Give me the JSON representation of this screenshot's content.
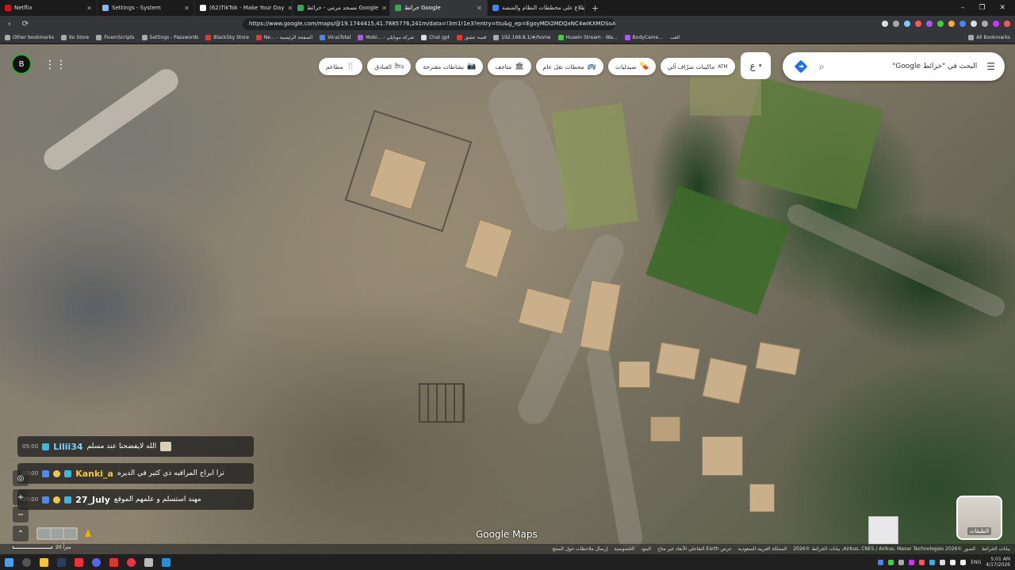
{
  "browser": {
    "tabs": [
      {
        "title": "Netflix",
        "color": "#e50914",
        "active": false
      },
      {
        "title": "Settings - System",
        "color": "#8ab4f8",
        "active": false
      },
      {
        "title": "(62)TikTok - Make Your Day",
        "color": "#ffffff",
        "active": false
      },
      {
        "title": "مسجد مرمي - خرائط Google",
        "color": "#34a853",
        "active": false
      },
      {
        "title": "خرائط Google",
        "color": "#34a853",
        "active": true
      },
      {
        "title": "الاطلاع على مخططات النظام والمنصة...",
        "color": "#4285f4",
        "active": false
      }
    ],
    "new_tab": "+",
    "window_controls": [
      "–",
      "❐",
      "✕"
    ],
    "url": "https://www.google.com/maps/@19.1744415,41.7885776,241m/data=!3m1!1e3?entry=ttu&g_ep=EgoyMDI2MDQxNC4wIKXMDSoASAFQ...",
    "nav": {
      "back": "‹",
      "forward": "›",
      "reload": "⟳"
    },
    "ext_colors": [
      "#ddd",
      "#aaa",
      "#7cf",
      "#f55",
      "#a5f",
      "#4c4",
      "#fa3",
      "#48f",
      "#ddd",
      "#aaa",
      "#c3f",
      "#f55"
    ],
    "bookmarks": [
      "Other bookmarks",
      "Ko Store",
      "FivemScripts",
      "Settings - Passwords",
      "BlackSky Store",
      "Ne... - الصفحة الرئيسية",
      "VirusTotal",
      "Mobi... - شركة موبايلي",
      "Chat gpt",
      "قصة عشق",
      "192.168.8.1/#/home",
      "Husein Stream - Wa...",
      "BodyCame...",
      "العب"
    ],
    "all_bookmarks": "All Bookmarks"
  },
  "maps": {
    "search_placeholder": "البحث في \"خرائط Google\"",
    "menu_icon": "☰",
    "search_icon": "⌕",
    "directions_icon": "◆",
    "lang_label": "ع",
    "chips": [
      {
        "label": "مطاعم",
        "icon": "🍴"
      },
      {
        "label": "الفنادق",
        "icon": "🛏"
      },
      {
        "label": "نشاطات مقترحة",
        "icon": "📷"
      },
      {
        "label": "متاحف",
        "icon": "🏛"
      },
      {
        "label": "محطات نقل عام",
        "icon": "🚌"
      },
      {
        "label": "صيدليات",
        "icon": "💊"
      },
      {
        "label": "ماكينات صرّاف آلي",
        "icon": "ATM"
      }
    ],
    "layers_label": "الطبقات",
    "logo": "Google Maps",
    "scale_label": "20 متراً",
    "footer": [
      "بيانات الخرائط",
      "الصور ©2026 Airbus, CNES / Airbus, Maxar Technologies, بيانات الخرائط ©2026",
      "المملكة العربية السعودية",
      "عرض Earth التفاعلي الأبعاد غير متاح",
      "البنود",
      "الخصوصية",
      "إرسال ملاحظات حول المنتج"
    ]
  },
  "chat": [
    {
      "time": "05:00",
      "user": "Lilii34",
      "user_color": "#7fd0ff",
      "message": "الله لايفضحنا عند مسلم"
    },
    {
      "time": "05:00",
      "user": "Kanki_a",
      "user_color": "#f5c542",
      "message": "ترا ابراج المراقبه ذي كثير في الديره"
    },
    {
      "time": "05:00",
      "user": "27_July",
      "user_color": "#ffffff",
      "message": "مهند استسلم و علمهم الموقع"
    }
  ],
  "system": {
    "lang": "ENG",
    "time": "5:01 AM",
    "date": "4/17/2026"
  }
}
